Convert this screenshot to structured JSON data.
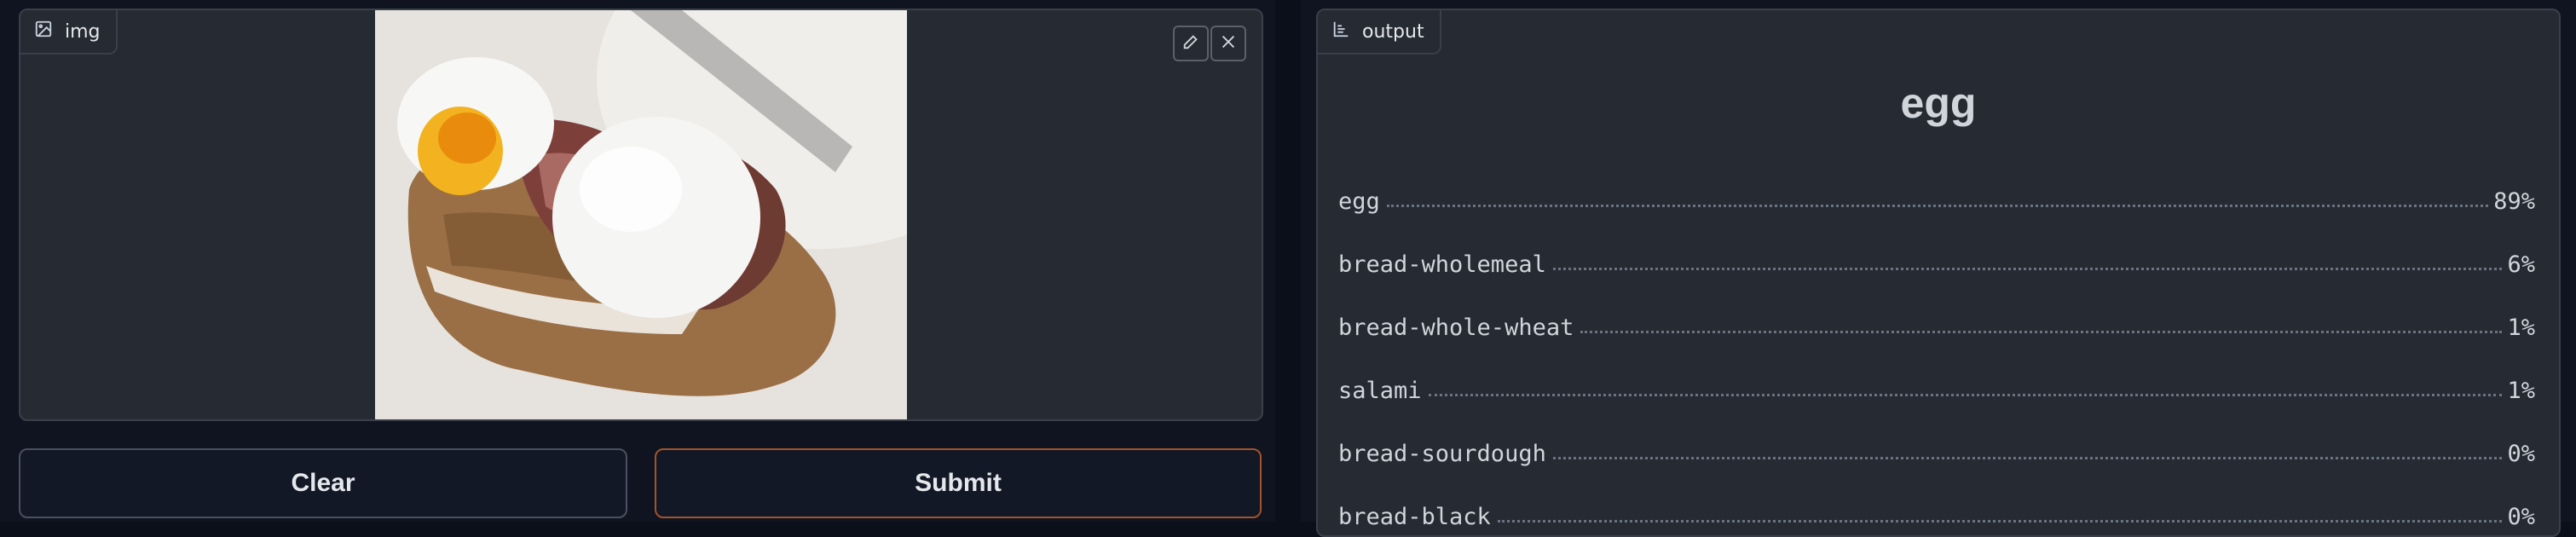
{
  "input": {
    "label": "img",
    "image_alt": "open-faced sandwich with halved boiled eggs and salami on a plate"
  },
  "buttons": {
    "clear": "Clear",
    "submit": "Submit"
  },
  "output": {
    "label": "output",
    "title": "egg",
    "results": [
      {
        "label": "egg",
        "value": "89%"
      },
      {
        "label": "bread-wholemeal",
        "value": "6%"
      },
      {
        "label": "bread-whole-wheat",
        "value": "1%"
      },
      {
        "label": "salami",
        "value": "1%"
      },
      {
        "label": "bread-sourdough",
        "value": "0%"
      },
      {
        "label": "bread-black",
        "value": "0%"
      }
    ]
  },
  "colors": {
    "background": "#0b0f19",
    "panel": "#262a33",
    "submit_border": "#a4532a"
  }
}
